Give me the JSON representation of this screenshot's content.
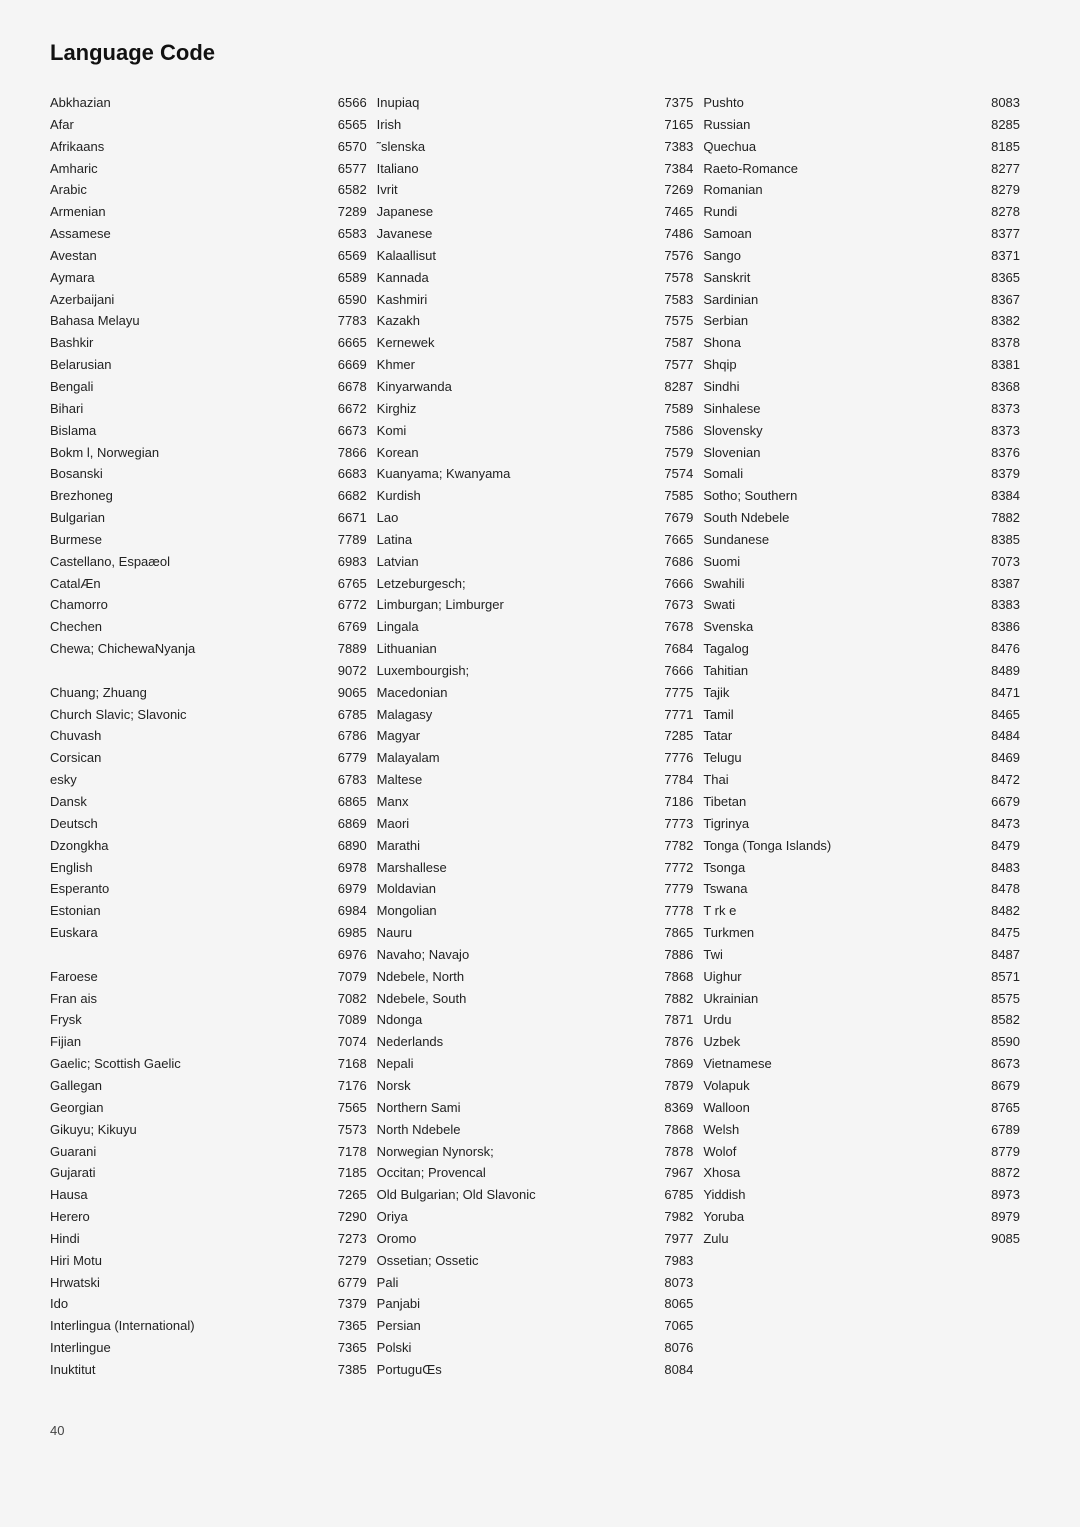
{
  "title": "Language Code",
  "page_number": "40",
  "columns": [
    {
      "id": "col1",
      "entries": [
        {
          "name": "Abkhazian",
          "code": "6566"
        },
        {
          "name": "Afar",
          "code": "6565"
        },
        {
          "name": "Afrikaans",
          "code": "6570"
        },
        {
          "name": "Amharic",
          "code": "6577"
        },
        {
          "name": "Arabic",
          "code": "6582"
        },
        {
          "name": "Armenian",
          "code": "7289"
        },
        {
          "name": "Assamese",
          "code": "6583"
        },
        {
          "name": "Avestan",
          "code": "6569"
        },
        {
          "name": "Aymara",
          "code": "6589"
        },
        {
          "name": "Azerbaijani",
          "code": "6590"
        },
        {
          "name": "Bahasa Melayu",
          "code": "7783"
        },
        {
          "name": "Bashkir",
          "code": "6665"
        },
        {
          "name": "Belarusian",
          "code": "6669"
        },
        {
          "name": "Bengali",
          "code": "6678"
        },
        {
          "name": "Bihari",
          "code": "6672"
        },
        {
          "name": "Bislama",
          "code": "6673"
        },
        {
          "name": "Bokm l, Norwegian",
          "code": "7866"
        },
        {
          "name": "Bosanski",
          "code": "6683"
        },
        {
          "name": "Brezhoneg",
          "code": "6682"
        },
        {
          "name": "Bulgarian",
          "code": "6671"
        },
        {
          "name": "Burmese",
          "code": "7789"
        },
        {
          "name": "Castellano, Espaæol",
          "code": "6983"
        },
        {
          "name": "CatalÆn",
          "code": "6765"
        },
        {
          "name": "Chamorro",
          "code": "6772"
        },
        {
          "name": "Chechen",
          "code": "6769"
        },
        {
          "name": "Chewa; ChichewaNyanja",
          "code": "7889"
        },
        {
          "name": "",
          "code": "9072"
        },
        {
          "name": "Chuang; Zhuang",
          "code": "9065"
        },
        {
          "name": "Church Slavic; Slavonic",
          "code": "6785"
        },
        {
          "name": "Chuvash",
          "code": "6786"
        },
        {
          "name": "Corsican",
          "code": "6779"
        },
        {
          "name": " esky",
          "code": "6783"
        },
        {
          "name": "Dansk",
          "code": "6865"
        },
        {
          "name": "Deutsch",
          "code": "6869"
        },
        {
          "name": "Dzongkha",
          "code": "6890"
        },
        {
          "name": "English",
          "code": "6978"
        },
        {
          "name": "Esperanto",
          "code": "6979"
        },
        {
          "name": "Estonian",
          "code": "6984"
        },
        {
          "name": "Euskara",
          "code": "6985"
        },
        {
          "name": "",
          "code": "6976"
        },
        {
          "name": "Faroese",
          "code": "7079"
        },
        {
          "name": "Fran ais",
          "code": "7082"
        },
        {
          "name": "Frysk",
          "code": "7089"
        },
        {
          "name": "Fijian",
          "code": "7074"
        },
        {
          "name": "Gaelic; Scottish Gaelic",
          "code": "7168"
        },
        {
          "name": "Gallegan",
          "code": "7176"
        },
        {
          "name": "Georgian",
          "code": "7565"
        },
        {
          "name": "Gikuyu; Kikuyu",
          "code": "7573"
        },
        {
          "name": "Guarani",
          "code": "7178"
        },
        {
          "name": "Gujarati",
          "code": "7185"
        },
        {
          "name": "Hausa",
          "code": "7265"
        },
        {
          "name": "Herero",
          "code": "7290"
        },
        {
          "name": "Hindi",
          "code": "7273"
        },
        {
          "name": "Hiri Motu",
          "code": "7279"
        },
        {
          "name": "Hrwatski",
          "code": "6779"
        },
        {
          "name": "Ido",
          "code": "7379"
        },
        {
          "name": "Interlingua (International)",
          "code": "7365"
        },
        {
          "name": "Interlingue",
          "code": "7365"
        },
        {
          "name": "Inuktitut",
          "code": "7385"
        }
      ]
    },
    {
      "id": "col2",
      "entries": [
        {
          "name": "Inupiaq",
          "code": "7375"
        },
        {
          "name": "Irish",
          "code": "7165"
        },
        {
          "name": "˜slenska",
          "code": "7383"
        },
        {
          "name": "Italiano",
          "code": "7384"
        },
        {
          "name": "Ivrit",
          "code": "7269"
        },
        {
          "name": "Japanese",
          "code": "7465"
        },
        {
          "name": "Javanese",
          "code": "7486"
        },
        {
          "name": "Kalaallisut",
          "code": "7576"
        },
        {
          "name": "Kannada",
          "code": "7578"
        },
        {
          "name": "Kashmiri",
          "code": "7583"
        },
        {
          "name": "Kazakh",
          "code": "7575"
        },
        {
          "name": "Kernewek",
          "code": "7587"
        },
        {
          "name": "Khmer",
          "code": "7577"
        },
        {
          "name": "Kinyarwanda",
          "code": "8287"
        },
        {
          "name": "Kirghiz",
          "code": "7589"
        },
        {
          "name": "Komi",
          "code": "7586"
        },
        {
          "name": "Korean",
          "code": "7579"
        },
        {
          "name": "Kuanyama; Kwanyama",
          "code": "7574"
        },
        {
          "name": "Kurdish",
          "code": "7585"
        },
        {
          "name": "Lao",
          "code": "7679"
        },
        {
          "name": "Latina",
          "code": "7665"
        },
        {
          "name": "Latvian",
          "code": "7686"
        },
        {
          "name": "Letzeburgesch;",
          "code": "7666"
        },
        {
          "name": "Limburgan; Limburger",
          "code": "7673"
        },
        {
          "name": "Lingala",
          "code": "7678"
        },
        {
          "name": "Lithuanian",
          "code": "7684"
        },
        {
          "name": "Luxembourgish;",
          "code": "7666"
        },
        {
          "name": "Macedonian",
          "code": "7775"
        },
        {
          "name": "Malagasy",
          "code": "7771"
        },
        {
          "name": "Magyar",
          "code": "7285"
        },
        {
          "name": "Malayalam",
          "code": "7776"
        },
        {
          "name": "Maltese",
          "code": "7784"
        },
        {
          "name": "Manx",
          "code": "7186"
        },
        {
          "name": "Maori",
          "code": "7773"
        },
        {
          "name": "Marathi",
          "code": "7782"
        },
        {
          "name": "Marshallese",
          "code": "7772"
        },
        {
          "name": "Moldavian",
          "code": "7779"
        },
        {
          "name": "Mongolian",
          "code": "7778"
        },
        {
          "name": "Nauru",
          "code": "7865"
        },
        {
          "name": "Navaho; Navajo",
          "code": "7886"
        },
        {
          "name": "Ndebele, North",
          "code": "7868"
        },
        {
          "name": "Ndebele, South",
          "code": "7882"
        },
        {
          "name": "Ndonga",
          "code": "7871"
        },
        {
          "name": "Nederlands",
          "code": "7876"
        },
        {
          "name": "Nepali",
          "code": "7869"
        },
        {
          "name": "Norsk",
          "code": "7879"
        },
        {
          "name": "Northern Sami",
          "code": "8369"
        },
        {
          "name": "North Ndebele",
          "code": "7868"
        },
        {
          "name": "Norwegian Nynorsk;",
          "code": "7878"
        },
        {
          "name": "Occitan; Provencal",
          "code": "7967"
        },
        {
          "name": "Old Bulgarian; Old Slavonic",
          "code": "6785"
        },
        {
          "name": "Oriya",
          "code": "7982"
        },
        {
          "name": "Oromo",
          "code": "7977"
        },
        {
          "name": "Ossetian; Ossetic",
          "code": "7983"
        },
        {
          "name": "Pali",
          "code": "8073"
        },
        {
          "name": "Panjabi",
          "code": "8065"
        },
        {
          "name": "Persian",
          "code": "7065"
        },
        {
          "name": "Polski",
          "code": "8076"
        },
        {
          "name": "PortuguŒs",
          "code": "8084"
        }
      ]
    },
    {
      "id": "col3",
      "entries": [
        {
          "name": "Pushto",
          "code": "8083"
        },
        {
          "name": "Russian",
          "code": "8285"
        },
        {
          "name": "Quechua",
          "code": "8185"
        },
        {
          "name": "Raeto-Romance",
          "code": "8277"
        },
        {
          "name": "Romanian",
          "code": "8279"
        },
        {
          "name": "Rundi",
          "code": "8278"
        },
        {
          "name": "Samoan",
          "code": "8377"
        },
        {
          "name": "Sango",
          "code": "8371"
        },
        {
          "name": "Sanskrit",
          "code": "8365"
        },
        {
          "name": "Sardinian",
          "code": "8367"
        },
        {
          "name": "Serbian",
          "code": "8382"
        },
        {
          "name": "Shona",
          "code": "8378"
        },
        {
          "name": "Shqip",
          "code": "8381"
        },
        {
          "name": "Sindhi",
          "code": "8368"
        },
        {
          "name": "Sinhalese",
          "code": "8373"
        },
        {
          "name": "Slovensky",
          "code": "8373"
        },
        {
          "name": "Slovenian",
          "code": "8376"
        },
        {
          "name": "Somali",
          "code": "8379"
        },
        {
          "name": "Sotho; Southern",
          "code": "8384"
        },
        {
          "name": "South Ndebele",
          "code": "7882"
        },
        {
          "name": "Sundanese",
          "code": "8385"
        },
        {
          "name": "Suomi",
          "code": "7073"
        },
        {
          "name": "Swahili",
          "code": "8387"
        },
        {
          "name": "Swati",
          "code": "8383"
        },
        {
          "name": "Svenska",
          "code": "8386"
        },
        {
          "name": "Tagalog",
          "code": "8476"
        },
        {
          "name": "Tahitian",
          "code": "8489"
        },
        {
          "name": "Tajik",
          "code": "8471"
        },
        {
          "name": "Tamil",
          "code": "8465"
        },
        {
          "name": "Tatar",
          "code": "8484"
        },
        {
          "name": "Telugu",
          "code": "8469"
        },
        {
          "name": "Thai",
          "code": "8472"
        },
        {
          "name": "Tibetan",
          "code": "6679"
        },
        {
          "name": "Tigrinya",
          "code": "8473"
        },
        {
          "name": "Tonga (Tonga Islands)",
          "code": "8479"
        },
        {
          "name": "Tsonga",
          "code": "8483"
        },
        {
          "name": "Tswana",
          "code": "8478"
        },
        {
          "name": "T rk e",
          "code": "8482"
        },
        {
          "name": "Turkmen",
          "code": "8475"
        },
        {
          "name": "Twi",
          "code": "8487"
        },
        {
          "name": "Uighur",
          "code": "8571"
        },
        {
          "name": "Ukrainian",
          "code": "8575"
        },
        {
          "name": "Urdu",
          "code": "8582"
        },
        {
          "name": "Uzbek",
          "code": "8590"
        },
        {
          "name": "Vietnamese",
          "code": "8673"
        },
        {
          "name": "Volapuk",
          "code": "8679"
        },
        {
          "name": "Walloon",
          "code": "8765"
        },
        {
          "name": "Welsh",
          "code": "6789"
        },
        {
          "name": "Wolof",
          "code": "8779"
        },
        {
          "name": "Xhosa",
          "code": "8872"
        },
        {
          "name": "Yiddish",
          "code": "8973"
        },
        {
          "name": "Yoruba",
          "code": "8979"
        },
        {
          "name": "Zulu",
          "code": "9085"
        }
      ]
    }
  ]
}
